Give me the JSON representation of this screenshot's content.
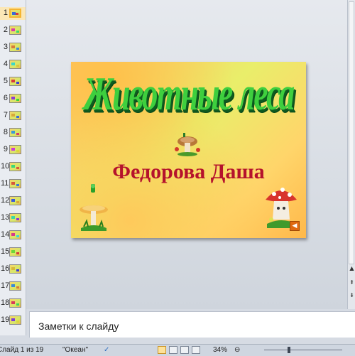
{
  "thumbnails": {
    "numbers": [
      "1",
      "2",
      "3",
      "4",
      "5",
      "6",
      "7",
      "8",
      "9",
      "10",
      "11",
      "12",
      "13",
      "14",
      "15",
      "16",
      "17",
      "18",
      "19"
    ],
    "selected_index": 0
  },
  "slide": {
    "title": "Животные леса",
    "subtitle": "Федорова  Даша",
    "sound_icon": "speaker-icon"
  },
  "notes": {
    "placeholder": "Заметки к слайду"
  },
  "status_bar": {
    "slide_counter": "Слайд 1 из 19",
    "theme": "\"Океан\"",
    "zoom": "34%"
  },
  "icons": {
    "spell_check": "spell-check-icon",
    "view_normal": "normal-view-icon",
    "view_sorter": "slide-sorter-icon",
    "view_show": "slideshow-icon"
  },
  "colors": {
    "title_green": "#3ecf3e",
    "title_shadow": "#0e5c20",
    "subtitle_red": "#b5122c",
    "selection": "#f5b532"
  }
}
